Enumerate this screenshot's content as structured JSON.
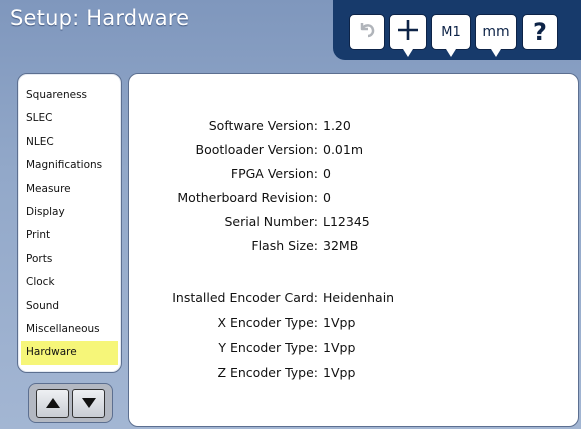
{
  "header": {
    "title": "Setup: Hardware"
  },
  "toolbar": {
    "undo_icon": "undo-icon",
    "plus_icon": "crosshair-plus-icon",
    "m1_label": "M1",
    "mm_label": "mm",
    "help_label": "?"
  },
  "sidebar": {
    "items": [
      {
        "label": "Squareness"
      },
      {
        "label": "SLEC"
      },
      {
        "label": "NLEC"
      },
      {
        "label": "Magnifications"
      },
      {
        "label": "Measure"
      },
      {
        "label": "Display"
      },
      {
        "label": "Print"
      },
      {
        "label": "Ports"
      },
      {
        "label": "Clock"
      },
      {
        "label": "Sound"
      },
      {
        "label": "Miscellaneous"
      },
      {
        "label": "Hardware",
        "selected": true
      }
    ],
    "highlight_color": "#f6f679"
  },
  "scroll": {
    "up_icon": "arrow-up-icon",
    "down_icon": "arrow-down-icon"
  },
  "details": {
    "rows": [
      {
        "label": "Software Version:",
        "value": "1.20"
      },
      {
        "label": "Bootloader Version:",
        "value": "0.01m"
      },
      {
        "label": "FPGA Version:",
        "value": "0"
      },
      {
        "label": "Motherboard Revision:",
        "value": "0"
      },
      {
        "label": "Serial Number:",
        "value": "L12345"
      },
      {
        "label": "Flash Size:",
        "value": "32MB"
      },
      {
        "label": "Installed Encoder Card:",
        "value": "Heidenhain"
      },
      {
        "label": "X Encoder Type:",
        "value": "1Vpp"
      },
      {
        "label": "Y Encoder Type:",
        "value": "1Vpp"
      },
      {
        "label": "Z Encoder Type:",
        "value": "1Vpp"
      }
    ]
  },
  "colors": {
    "toolbar_bg": "#173a6b",
    "screen_bg": "#92a8c9"
  }
}
